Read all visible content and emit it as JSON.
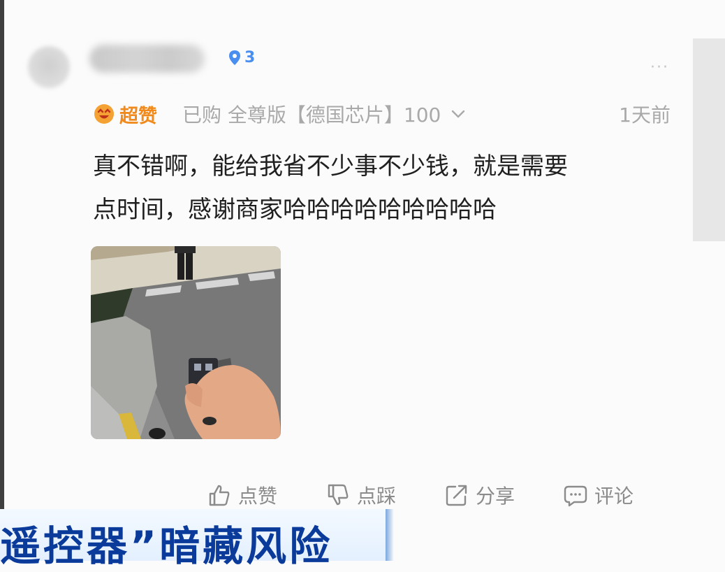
{
  "comment": {
    "user_level": "3",
    "more_glyph": "···",
    "badge_label": "超赞",
    "purchase_info": "已购 全尊版【德国芯片】100",
    "time_ago": "1天前",
    "review_lines": [
      "真不错啊，能给我省不少事不少钱，就是需要",
      "点时间，感谢商家哈哈哈哈哈哈哈哈哈"
    ]
  },
  "actions": {
    "like_label": "点赞",
    "dislike_label": "点踩",
    "share_label": "分享",
    "comment_label": "评论"
  },
  "ticker": {
    "text": "遥控器”暗藏风险"
  },
  "colors": {
    "accent_orange": "#f08a1c",
    "level_blue": "#4a8ff0",
    "ticker_navy": "#0a3a9a"
  },
  "icons": [
    "level-shield-icon",
    "more-icon",
    "smile-badge-icon",
    "chevron-down-icon",
    "thumbs-up-icon",
    "thumbs-down-icon",
    "share-icon",
    "comment-icon"
  ]
}
